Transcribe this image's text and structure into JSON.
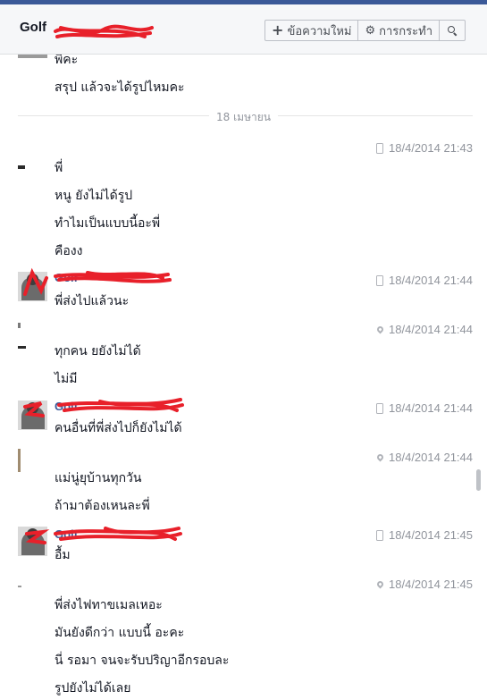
{
  "header": {
    "conversation_name": "Golf",
    "new_message_label": "ข้อความใหม่",
    "actions_label": "การกระทำ"
  },
  "date_separator": "18 เมษายน",
  "messages_top": [
    "พี่คะ",
    "สรุป แล้วจะได้รูปไหมคะ"
  ],
  "groups": [
    {
      "sender": "",
      "timestamp": "18/4/2014 21:43",
      "source": "mobile",
      "lines": [
        "พี่",
        "หนู ยังไม่ได้รูป",
        "ทำไมเป็นแบบนี้อะพี่",
        "คืองง"
      ]
    },
    {
      "sender": "Golf",
      "timestamp": "18/4/2014 21:44",
      "source": "mobile",
      "lines": [
        "พี่ส่งไปแล้วนะ"
      ]
    },
    {
      "sender": "",
      "timestamp": "18/4/2014 21:44",
      "source": "location",
      "lines": [
        "ทุกคน ยยังไม่ได้",
        "ไม่มี"
      ]
    },
    {
      "sender": "Golf",
      "timestamp": "18/4/2014 21:44",
      "source": "mobile",
      "lines": [
        "คนอื่นที่พี่ส่งไปก็ยังไม่ได้"
      ]
    },
    {
      "sender": "",
      "timestamp": "18/4/2014 21:44",
      "source": "location",
      "lines": [
        "แม่นู่ยุบ้านทุกวัน",
        "ถ้ามาต้องเหนละพี่"
      ]
    },
    {
      "sender": "Golf",
      "timestamp": "18/4/2014 21:45",
      "source": "mobile",
      "lines": [
        "อื้ม"
      ]
    },
    {
      "sender": "",
      "timestamp": "18/4/2014 21:45",
      "source": "location",
      "lines": [
        "พี่ส่งไฟทาขเมลเหอะ",
        "มันยังดีกว่า แบบนี้ อะคะ",
        "นี่ รอมา จนจะรับปริญาอีกรอบละ",
        "รูปยังไม่ได้เลย"
      ]
    }
  ],
  "icons": {
    "new_message": "plus-icon",
    "actions": "gear-icon",
    "search": "search-icon",
    "mobile": "phone-icon",
    "location": "pin-icon"
  },
  "colors": {
    "brand": "#3b5998",
    "meta_text": "#90949c",
    "redaction": "#e8202a"
  }
}
